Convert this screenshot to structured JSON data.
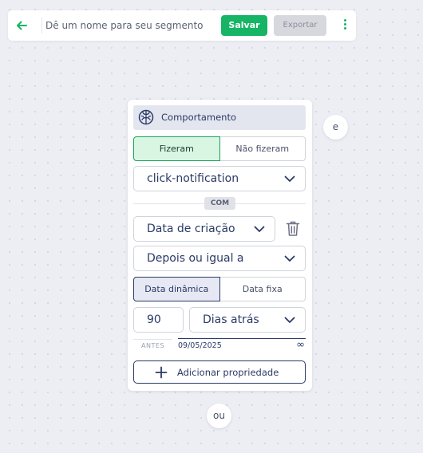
{
  "topbar": {
    "back_icon": "arrow-left-icon",
    "name_placeholder": "Dê um nome para seu segmento",
    "name_value": "",
    "save_label": "Salvar",
    "export_label": "Exportar",
    "more_icon": "kebab-vertical-icon"
  },
  "colors": {
    "accent_green": "#16b565",
    "navy": "#2b3a67",
    "active_green_bg": "#d9f6e3",
    "disabled_bg": "#d6d8de",
    "canvas_bg": "#eceef3"
  },
  "card": {
    "header": {
      "icon": "brain-icon",
      "title": "Comportamento"
    },
    "did_toggle": {
      "options": [
        "Fizeram",
        "Não fizeram"
      ],
      "selected": "Fizeram"
    },
    "event_select": {
      "value": "click-notification"
    },
    "connector": "COM",
    "property_select": {
      "value": "Data de criação"
    },
    "delete_icon": "trash-icon",
    "operator_select": {
      "value": "Depois ou igual a"
    },
    "date_mode": {
      "options": [
        "Data dinâmica",
        "Data fixa"
      ],
      "selected": "Data dinâmica"
    },
    "amount": "90",
    "unit_select": {
      "value": "Dias atrás"
    },
    "range": {
      "before_label": "ANTES",
      "date": "09/05/2025",
      "end": "∞"
    },
    "add_property": {
      "icon": "plus-icon",
      "label": "Adicionar propriedade"
    }
  },
  "connectors": {
    "and_label": "e",
    "or_label": "ou"
  }
}
